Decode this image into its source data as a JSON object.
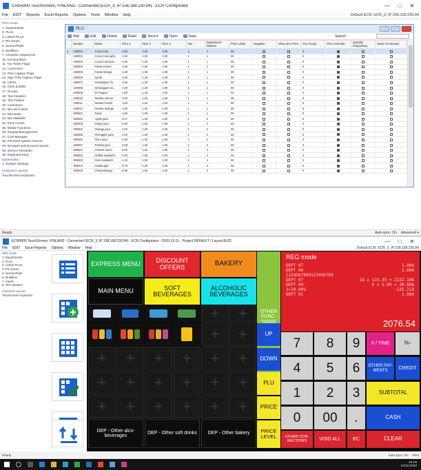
{
  "window1": {
    "title": "CHD5800 TouchScreen, FINLAND - Connected (ECR_3, IP 158.168.230.84) - ECR Configurator",
    "menu": [
      "File",
      "EDIT",
      "Reports",
      "Excel Reports",
      "Options",
      "Tools",
      "Window",
      "Help"
    ],
    "menu_right": "Default ECR:  ECR_3, IP 158.168.230.84",
    "nav_header": "PRG-mode",
    "nav_items": [
      "1. Departments",
      "2. PLUs",
      "3. Linked PLUs",
      "4. Pfx Zones",
      "5. Screen/Pads",
      "6. Modifiers",
      "7. Activation sequences",
      "10. Cat Numbers",
      "11. Tax Ticket Flags",
      "12. Currencies",
      "13. Print Caption Flags",
      "14. Sign Print Caption Flags",
      "15. Clerks",
      "16. Clerk profiles",
      "17. Groups",
      "18. Text Headers",
      "19. Text Trailers",
      "20. Customers",
      "21. Mix and match",
      "22. Discounts",
      "23. Mix Mabdefs",
      "24. Price Levels",
      "25. Media Functions",
      "26. Keypad Management",
      "27. Conf Manager",
      "28. Pre-fixed system macros",
      "29. Receipts and account reports",
      "30. Service Reminder",
      "35. Keyboard Keys"
    ],
    "nav_sub": [
      "Systemdata",
      "1. System Settings"
    ],
    "nav_layout_header": "Keyboard Layouts",
    "nav_layout_items": [
      "Touchscreen Keyboard"
    ],
    "status_left": "Ready",
    "status_right": "Auto-sync: On",
    "status_right2": "Advanced ▾"
  },
  "plu": {
    "title": "PLU",
    "tools": [
      "Add",
      "Edit",
      "Delete",
      "Read",
      "Send ▾",
      "Open",
      "Save"
    ],
    "search_label": "Search",
    "columns": [
      "Number",
      "Name",
      "Price 1",
      "Price 2",
      "Price 3",
      "Tax",
      "Department Number",
      "Price Limits",
      "Negative",
      "Allow Zero Price",
      "PLU Group",
      "Price Override",
      "Quantity Compulsory",
      "Stock On Receipt"
    ],
    "rows": [
      [
        "100001",
        "Coca-Cola",
        "1.50",
        "1.25",
        "1.00",
        "1",
        "1",
        "00",
        false,
        false,
        "0",
        true,
        false,
        false
      ],
      [
        "100002",
        "Coca-Cola Light",
        "1.50",
        "1.25",
        "1.00",
        "1",
        "1",
        "00",
        false,
        false,
        "0",
        true,
        false,
        false
      ],
      [
        "100003",
        "Coca-Cola Zero",
        "1.50",
        "1.25",
        "1.00",
        "1",
        "1",
        "00",
        false,
        false,
        "0",
        true,
        false,
        false
      ],
      [
        "100004",
        "Fanta Lemon",
        "1.50",
        "1.25",
        "1.00",
        "1",
        "1",
        "00",
        false,
        false,
        "0",
        true,
        false,
        false
      ],
      [
        "100005",
        "Fanta Orange",
        "1.50",
        "1.25",
        "1.00",
        "1",
        "1",
        "00",
        false,
        false,
        "0",
        true,
        false,
        false
      ],
      [
        "100006",
        "Sprite",
        "1.50",
        "1.25",
        "1.00",
        "1",
        "1",
        "00",
        false,
        false,
        "0",
        true,
        false,
        false
      ],
      [
        "100007",
        "Schweppes To...",
        "1.50",
        "1.25",
        "1.00",
        "1",
        "1",
        "00",
        false,
        false,
        "0",
        true,
        false,
        false
      ],
      [
        "100008",
        "Schweppes Gi...",
        "1.50",
        "1.25",
        "1.00",
        "1",
        "1",
        "00",
        false,
        false,
        "0",
        true,
        false,
        false
      ],
      [
        "100009",
        "Dr Pepper",
        "1.50",
        "1.25",
        "1.00",
        "1",
        "1",
        "00",
        false,
        false,
        "0",
        true,
        false,
        false
      ],
      [
        "100010",
        "Nestea Lemon",
        "1.50",
        "1.25",
        "1.00",
        "1",
        "1",
        "00",
        false,
        false,
        "0",
        true,
        false,
        false
      ],
      [
        "100011",
        "Nestea Peach",
        "1.50",
        "1.25",
        "1.00",
        "1",
        "1",
        "00",
        false,
        false,
        "0",
        true,
        false,
        false
      ],
      [
        "100012",
        "Nestea Orange",
        "1.50",
        "1.25",
        "1.00",
        "1",
        "1",
        "00",
        false,
        false,
        "0",
        true,
        false,
        false
      ],
      [
        "200001",
        "Pepsi",
        "1.50",
        "1.25",
        "1.00",
        "1",
        "1",
        "00",
        false,
        false,
        "0",
        true,
        false,
        false
      ],
      [
        "200002",
        "Apple juice",
        "2.47",
        "1.25",
        "1.00",
        "1",
        "2",
        "00",
        false,
        false,
        "0",
        true,
        false,
        false
      ],
      [
        "200003",
        "Grape juice",
        "2.00",
        "1.25",
        "1.00",
        "1",
        "2",
        "00",
        false,
        false,
        "0",
        true,
        false,
        false
      ],
      [
        "200004",
        "Orange juice",
        "2.00",
        "1.25",
        "1.00",
        "1",
        "2",
        "00",
        false,
        false,
        "0",
        true,
        false,
        false
      ],
      [
        "200005",
        "Pineapple juice",
        "2.00",
        "1.25",
        "1.00",
        "1",
        "2",
        "00",
        false,
        false,
        "0",
        true,
        false,
        false
      ],
      [
        "200006",
        "Plum juice",
        "2.00",
        "1.25",
        "1.00",
        "1",
        "2",
        "00",
        false,
        false,
        "0",
        true,
        false,
        false
      ],
      [
        "200007",
        "Tomato juice",
        "2.00",
        "1.25",
        "1.00",
        "1",
        "2",
        "00",
        false,
        false,
        "0",
        true,
        false,
        false
      ],
      [
        "300001",
        "Cheese sand...",
        "4.00",
        "1.25",
        "1.00",
        "1",
        "3",
        "00",
        false,
        false,
        "0",
        true,
        false,
        false
      ],
      [
        "300002",
        "Grilled sandwich",
        "4.00",
        "1.25",
        "1.00",
        "1",
        "3",
        "00",
        false,
        false,
        "0",
        true,
        false,
        false
      ],
      [
        "300003",
        "Ham sandwich",
        "1.10",
        "1.25",
        "1.00",
        "1",
        "3",
        "00",
        false,
        false,
        "0",
        true,
        false,
        false
      ],
      [
        "300004",
        "Hamburger",
        "0.70",
        "1.25",
        "1.00",
        "1",
        "3",
        "00",
        false,
        false,
        "0",
        true,
        false,
        false
      ],
      [
        "300005",
        "Cheeseburger",
        "0.90",
        "1.25",
        "1.00",
        "1",
        "3",
        "00",
        false,
        false,
        "0",
        true,
        false,
        false
      ]
    ]
  },
  "window2": {
    "title": "ECR6800 TouchScreen, FINLAND - Connected (ECR_3, IP 158.168.230.84) - ECR Configurator - 2020-12-01 - Project DEFAULT / Layout BL02",
    "menu": [
      "File",
      "EDIT",
      "Excel Reports",
      "Options",
      "Window",
      "Help"
    ],
    "menu_right": "Default ECR:  ECR_3, IP 158.168.230.84",
    "nav_header": "PRG-mode",
    "nav_items": [
      "1. Departments",
      "2. PLUs",
      "3. Linked PLUs",
      "4. Pfx Zones",
      "5. Screen/Pads",
      "6. Modifiers",
      "7. Clerks",
      "8. Text Headers"
    ],
    "nav_layout_header": "Keyboard Layouts",
    "nav_layout_items": [
      "Touchscreen Keyboard"
    ],
    "status_left": "Ready",
    "status_right": "Auto-sync: On",
    "status_right2": "Print"
  },
  "keyboard": {
    "express_menu": "EXPRESS MENU",
    "discount_offers": "DISCOUNT OFFERS",
    "bakery": "BAKERY",
    "main_menu": "MAIN MENU",
    "soft_beverages": "SOFT BEVERAGES",
    "alcoholic_beverages": "ALCOHOLIC BEVERAGES",
    "other_functions": "OTHER FUNC-TIONS",
    "dep_alco": "DEP - Other alco-beverages",
    "dep_soft": "DEP - Other soft drinks",
    "dep_bakery": "DEP - Other bakery",
    "plus_glyph": "+",
    "up": "UP",
    "down": "DOWN",
    "plu": "PLU",
    "price": "PRICE",
    "price_level": "PRICE LEVEL",
    "n7": "7",
    "n8": "8",
    "n9": "9",
    "n4": "4",
    "n5": "5",
    "n6": "6",
    "n1": "1",
    "n2": "2",
    "n3": "3",
    "n0": "0",
    "n00": "00",
    "dot": ".",
    "x_time": "X / TIME",
    "pct_minus": "%-",
    "other_payments": "OTHER PAY-MENTS",
    "credit": "CREDIT",
    "subtotal": "SUBTOTAL",
    "cash": "CASH",
    "other_corrections": "OTHER COR-RECTIONS",
    "void_all": "VOID ALL",
    "ec": "EC",
    "clear": "CLEAR"
  },
  "display": {
    "mode": "REG mode",
    "lines": [
      {
        "l": "DEPT 07",
        "r": "1.00A"
      },
      {
        "l": "DEPT 06",
        "r": "2.00A"
      },
      {
        "l": "1234567890123456789",
        "r": ""
      },
      {
        "l": "DEPT 07",
        "r": "18 x 123.45 = 2222.10A"
      },
      {
        "l": "DEPT 09",
        "r": "6 x 5.00 = 30.00A"
      },
      {
        "l": "1=10.00%",
        "r": "-225.21A"
      },
      {
        "l": "DEPT 01",
        "r": "1.00A"
      }
    ],
    "total": "2076.54"
  },
  "taskbar": {
    "time": "16:15",
    "date": "16/11/2020"
  }
}
